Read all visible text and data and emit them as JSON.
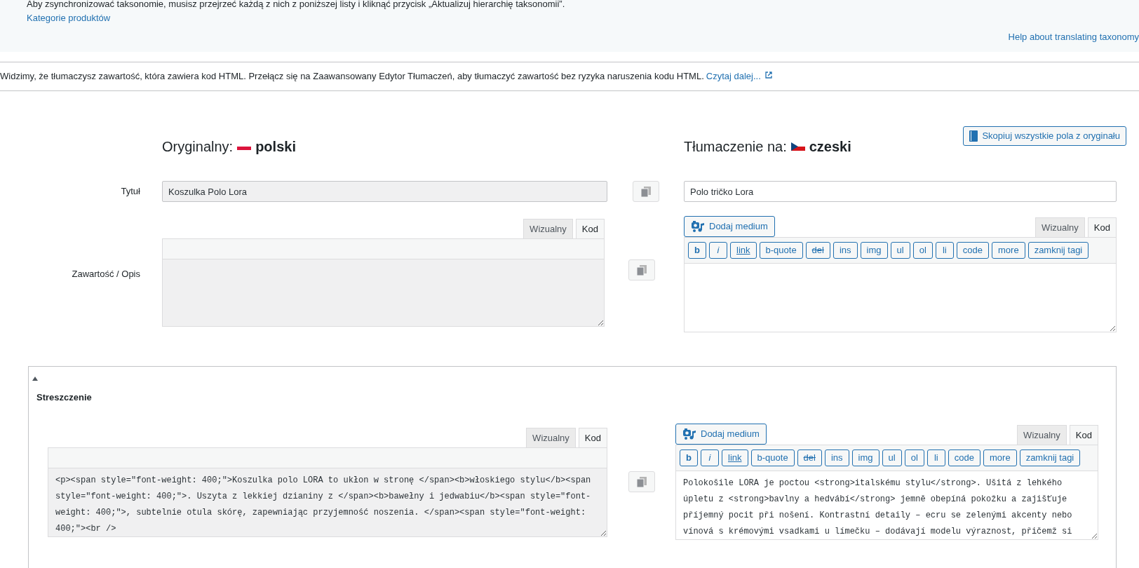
{
  "notice": {
    "text": "Aby zsynchronizować taksonomie, musisz przejrzeć każdą z nich z poniższej listy i kliknąć przycisk „Aktualizuj hierarchię taksonomii”.",
    "link": "Kategorie produktów",
    "help_link": "Help about translating taxonomy"
  },
  "html_warning": {
    "text": "Widzimy, że tłumaczysz zawartość, która zawiera kod HTML. Przełącz się na Zaawansowany Edytor Tłumaczeń, aby tłumaczyć zawartość bez ryzyka naruszenia kodu HTML.",
    "link": "Czytaj dalej..."
  },
  "original": {
    "label": "Oryginalny:",
    "language": "polski"
  },
  "translation": {
    "label": "Tłumaczenie na:",
    "language": "czeski"
  },
  "copy_all_button": "Skopiuj wszystkie pola z oryginału",
  "fields": [
    {
      "kind": "text",
      "label": "Tytuł",
      "original": {
        "value": "Koszulka Polo Lora"
      },
      "translation": {
        "value": "Polo tričko Lora"
      }
    },
    {
      "kind": "editor",
      "label": "Zawartość / Opis",
      "original": {
        "tabs": [
          {
            "label": "Wizualny",
            "selected": false
          },
          {
            "label": "Kod",
            "selected": true
          }
        ]
      },
      "translation": {
        "media_button": "Dodaj medium",
        "tabs": [
          {
            "label": "Wizualny",
            "selected": false
          },
          {
            "label": "Kod",
            "selected": true
          }
        ],
        "toolbar": [
          {
            "label": "b",
            "kind": "bold"
          },
          {
            "label": "i",
            "kind": "italic"
          },
          {
            "label": "link",
            "kind": "underline"
          },
          {
            "label": "b-quote",
            "kind": "plain"
          },
          {
            "label": "del",
            "kind": "strike"
          },
          {
            "label": "ins",
            "kind": "plain"
          },
          {
            "label": "img",
            "kind": "plain"
          },
          {
            "label": "ul",
            "kind": "plain"
          },
          {
            "label": "ol",
            "kind": "plain"
          },
          {
            "label": "li",
            "kind": "plain"
          },
          {
            "label": "code",
            "kind": "plain"
          },
          {
            "label": "more",
            "kind": "plain"
          },
          {
            "label": "zamknij tagi",
            "kind": "plain"
          }
        ]
      }
    }
  ],
  "summary": {
    "title": "Streszczenie",
    "expanded": true,
    "original": {
      "tabs": [
        {
          "label": "Wizualny",
          "selected": false
        },
        {
          "label": "Kod",
          "selected": true
        }
      ],
      "value": "<p><span style=\"font-weight: 400;\">Koszulka polo LORA to ukłon w stronę </span><b>włoskiego stylu</b><span style=\"font-weight: 400;\">. Uszyta z lekkiej dzianiny z </span><b>bawełny i jedwabiu</b><span style=\"font-weight: 400;\">, subtelnie otula skórę, zapewniając przyjemność noszenia. </span><span style=\"font-weight: 400;\"><br />"
    },
    "translation": {
      "media_button": "Dodaj medium",
      "tabs": [
        {
          "label": "Wizualny",
          "selected": false
        },
        {
          "label": "Kod",
          "selected": true
        }
      ],
      "toolbar": [
        {
          "label": "b",
          "kind": "bold"
        },
        {
          "label": "i",
          "kind": "italic"
        },
        {
          "label": "link",
          "kind": "underline"
        },
        {
          "label": "b-quote",
          "kind": "plain"
        },
        {
          "label": "del",
          "kind": "strike"
        },
        {
          "label": "ins",
          "kind": "plain"
        },
        {
          "label": "img",
          "kind": "plain"
        },
        {
          "label": "ul",
          "kind": "plain"
        },
        {
          "label": "ol",
          "kind": "plain"
        },
        {
          "label": "li",
          "kind": "plain"
        },
        {
          "label": "code",
          "kind": "plain"
        },
        {
          "label": "more",
          "kind": "plain"
        },
        {
          "label": "zamknij tagi",
          "kind": "plain"
        }
      ],
      "value": "Polokošile LORA je poctou <strong>italskému stylu</strong>. Ušitá z lehkého úpletu z <strong>bavlny a hedvábí</strong> jemně obepíná pokožku a zajišťuje příjemný pocit při nošení. Kontrastní detaily – ecru se zelenými akcenty nebo vínová s krémovými vsadkami u límečku – dodávají modelu výraznost, přičemž si"
    }
  }
}
